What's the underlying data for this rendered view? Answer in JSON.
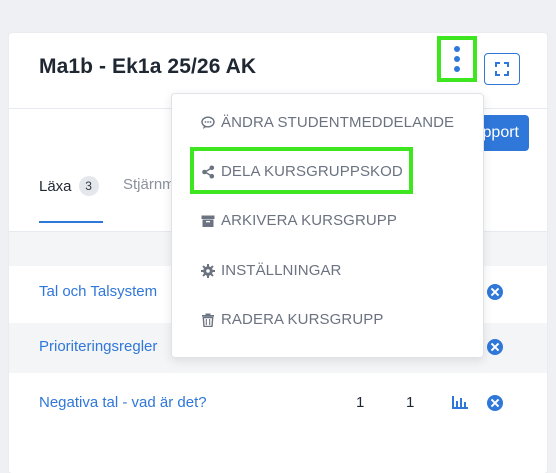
{
  "card": {
    "title": "Ma1b - Ek1a 25/26 AK",
    "report_label": "pport"
  },
  "tabs": [
    {
      "label": "Läxa",
      "badge": "3"
    },
    {
      "label": "Stjärnm"
    }
  ],
  "rows": [
    {
      "name": "Tal och Talsystem",
      "col1": "",
      "col2": ""
    },
    {
      "name": "Prioriteringsregler",
      "col1": "",
      "col2": ""
    },
    {
      "name": "Negativa tal - vad är det?",
      "col1": "1",
      "col2": "1"
    }
  ],
  "menu": {
    "items": [
      {
        "label": "ÄNDRA STUDENTMEDDELANDE",
        "icon": "comment-icon"
      },
      {
        "label": "DELA KURSGRUPPSKOD",
        "icon": "share-icon"
      },
      {
        "label": "ARKIVERA KURSGRUPP",
        "icon": "archive-icon"
      },
      {
        "label": "INSTÄLLNINGAR",
        "icon": "gear-icon"
      },
      {
        "label": "RADERA KURSGRUPP",
        "icon": "trash-icon"
      }
    ]
  },
  "colors": {
    "accent": "#2f77d9",
    "highlight": "#3ee61f",
    "menu_text": "#6b7380"
  }
}
